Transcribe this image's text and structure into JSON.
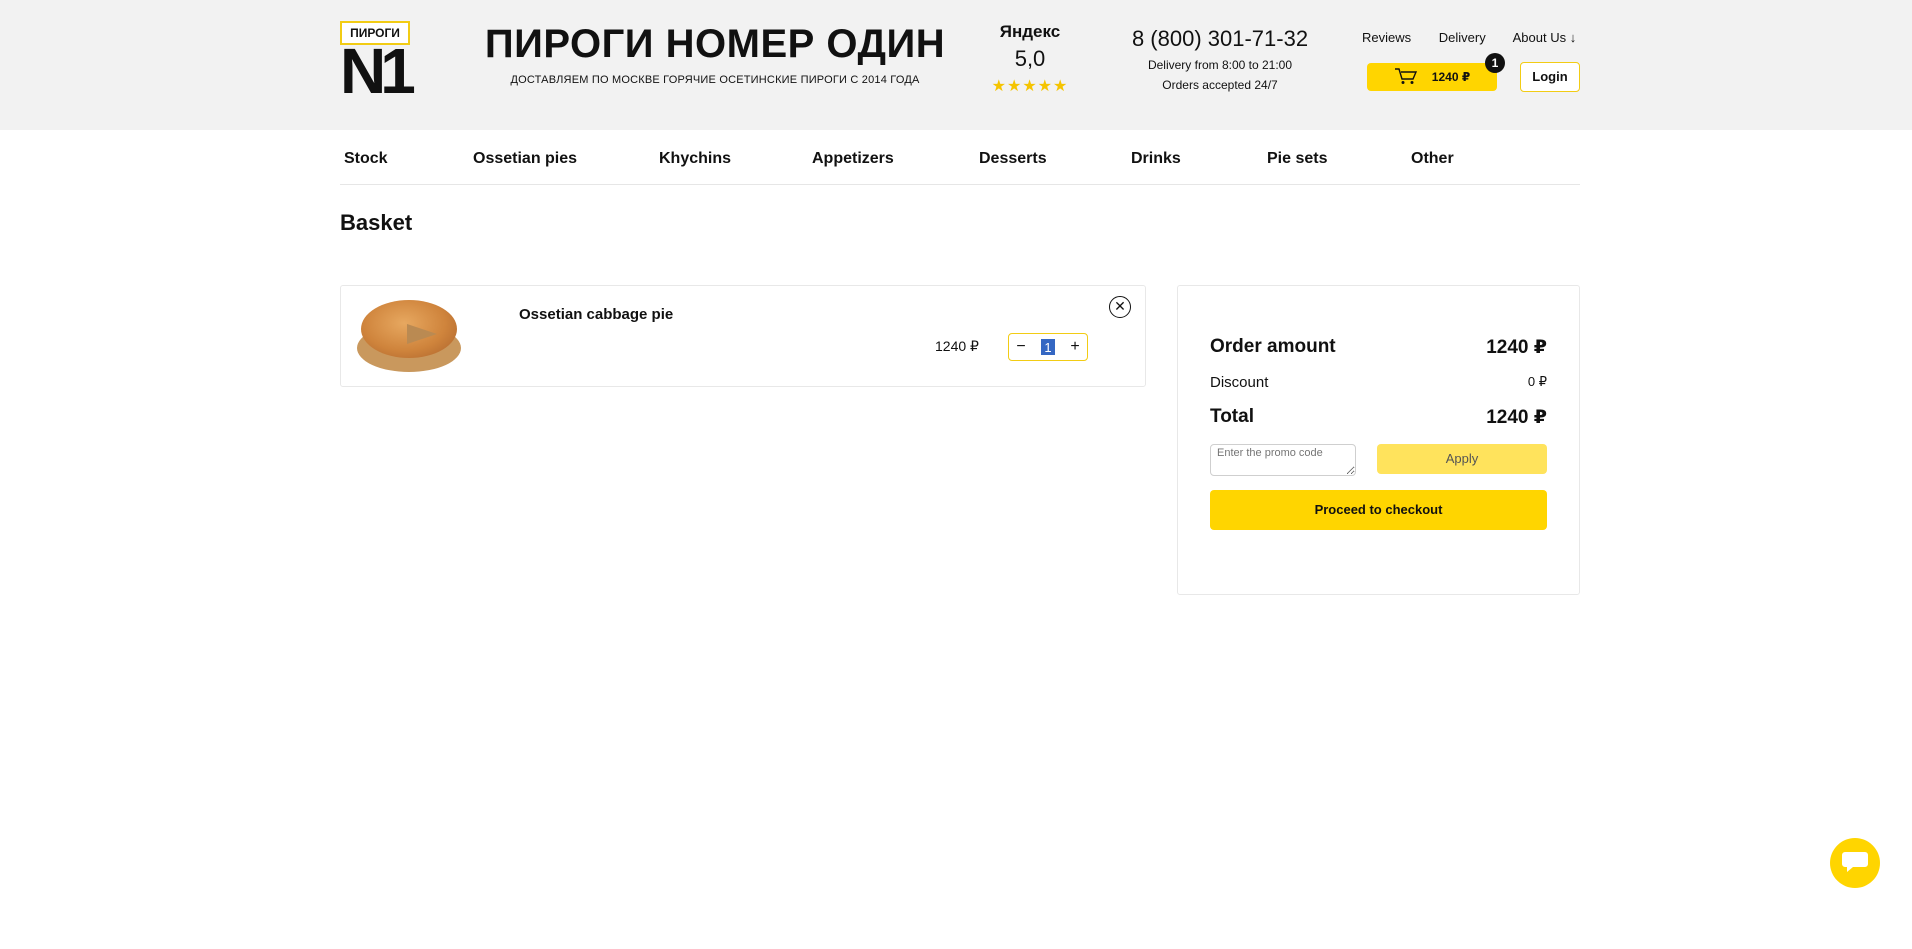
{
  "header": {
    "logo": {
      "tag": "ПИРОГИ",
      "mark": "N1"
    },
    "brand_title": "ПИРОГИ НОМЕР ОДИН",
    "brand_subtitle": "ДОСТАВЛЯЕМ ПО МОСКВЕ ГОРЯЧИЕ ОСЕТИНСКИЕ ПИРОГИ С 2014 ГОДА",
    "rating": {
      "name": "Яндекс",
      "score": "5,0",
      "stars": "★★★★★"
    },
    "phone": "8 (800) 301-71-32",
    "delivery_hours": "Delivery from 8:00 to 21:00",
    "orders_note": "Orders accepted 24/7",
    "links": {
      "reviews": "Reviews",
      "delivery": "Delivery",
      "about": "About Us ↓"
    },
    "cart": {
      "amount": "1240 ₽",
      "count": "1"
    },
    "login": "Login"
  },
  "nav": {
    "stock": "Stock",
    "ossetian_pies": "Ossetian pies",
    "khychins": "Khychins",
    "appetizers": "Appetizers",
    "desserts": "Desserts",
    "drinks": "Drinks",
    "pie_sets": "Pie sets",
    "other": "Other"
  },
  "basket": {
    "title": "Basket",
    "item": {
      "name": "Ossetian cabbage pie",
      "price": "1240 ₽",
      "quantity": "1",
      "minus": "−",
      "plus": "+",
      "remove": "✕"
    }
  },
  "summary": {
    "order_amount_label": "Order amount",
    "order_amount": "1240 ₽",
    "discount_label": "Discount",
    "discount": "0 ₽",
    "total_label": "Total",
    "total": "1240 ₽",
    "promo_placeholder": "Enter the promo code",
    "apply": "Apply",
    "checkout": "Proceed to checkout"
  },
  "colors": {
    "accent": "#ffd500",
    "header_bg": "#f2f2f2"
  },
  "icons": {
    "cart": "cart-icon",
    "chat": "chat-icon",
    "close": "close-icon"
  }
}
